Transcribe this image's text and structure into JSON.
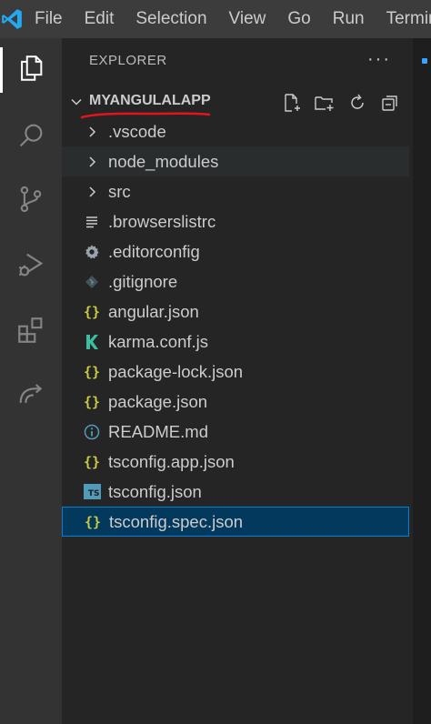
{
  "menubar": {
    "logo_icon": "vscode-logo-icon",
    "items": [
      "File",
      "Edit",
      "Selection",
      "View",
      "Go",
      "Run",
      "Terminal"
    ]
  },
  "activity_bar": {
    "items": [
      {
        "icon": "files-icon",
        "active": true
      },
      {
        "icon": "search-icon",
        "active": false
      },
      {
        "icon": "source-control-icon",
        "active": false
      },
      {
        "icon": "run-debug-icon",
        "active": false
      },
      {
        "icon": "extensions-icon",
        "active": false
      },
      {
        "icon": "remote-explorer-icon",
        "active": false
      }
    ]
  },
  "explorer": {
    "title": "EXPLORER",
    "more": "···",
    "folder": {
      "name": "MYANGULALAPP",
      "annotation_color": "#e5141b",
      "actions": [
        "new-file-icon",
        "new-folder-icon",
        "refresh-icon",
        "collapse-all-icon"
      ]
    },
    "items": [
      {
        "label": ".vscode",
        "type": "folder",
        "icon": "chevron-right-icon"
      },
      {
        "label": "node_modules",
        "type": "folder",
        "icon": "chevron-right-icon"
      },
      {
        "label": "src",
        "type": "folder",
        "icon": "chevron-right-icon"
      },
      {
        "label": ".browserslistrc",
        "type": "file",
        "icon": "lines-icon"
      },
      {
        "label": ".editorconfig",
        "type": "file",
        "icon": "gear-icon"
      },
      {
        "label": ".gitignore",
        "type": "file",
        "icon": "git-icon"
      },
      {
        "label": "angular.json",
        "type": "file",
        "icon": "json-icon"
      },
      {
        "label": "karma.conf.js",
        "type": "file",
        "icon": "karma-icon"
      },
      {
        "label": "package-lock.json",
        "type": "file",
        "icon": "json-icon"
      },
      {
        "label": "package.json",
        "type": "file",
        "icon": "json-icon"
      },
      {
        "label": "README.md",
        "type": "file",
        "icon": "info-icon"
      },
      {
        "label": "tsconfig.app.json",
        "type": "file",
        "icon": "json-icon"
      },
      {
        "label": "tsconfig.json",
        "type": "file",
        "icon": "typescript-icon"
      },
      {
        "label": "tsconfig.spec.json",
        "type": "file",
        "icon": "json-icon",
        "selected": true
      }
    ],
    "json_icon_glyph": "{}",
    "ts_badge_text": "TS"
  },
  "colors": {
    "menubar_bg": "#3c3c3c",
    "activity_bg": "#333333",
    "sidebar_bg": "#252526",
    "selection_bg": "#04395e",
    "selection_border": "#007fd4",
    "json_icon": "#cbcb41",
    "vscode_blue": "#23a9f2"
  }
}
